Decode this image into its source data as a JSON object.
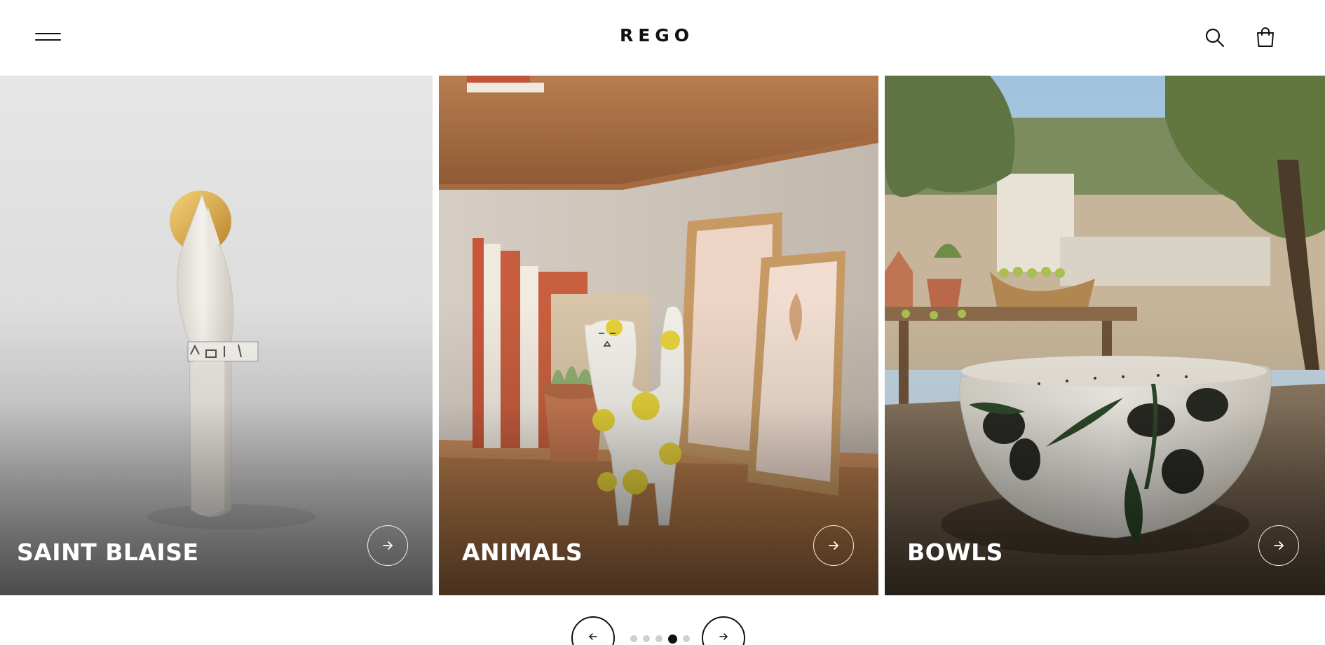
{
  "header": {
    "logo": "REGO",
    "menu_icon": "hamburger-menu-icon",
    "search_icon": "search-icon",
    "cart_icon": "shopping-bag-icon"
  },
  "cards": [
    {
      "title": "SAINT BLAISE",
      "icon": "arrow-right-icon"
    },
    {
      "title": "ANIMALS",
      "icon": "arrow-right-icon"
    },
    {
      "title": "BOWLS",
      "icon": "arrow-right-icon"
    }
  ],
  "carousel": {
    "prev_icon": "arrow-left-icon",
    "next_icon": "arrow-right-icon",
    "total_slides": 5,
    "active_slide": 4
  },
  "colors": {
    "text": "#111111",
    "background": "#ffffff",
    "dot_inactive": "#cfcfcf",
    "dot_active": "#111111",
    "card_text": "#ffffff"
  }
}
